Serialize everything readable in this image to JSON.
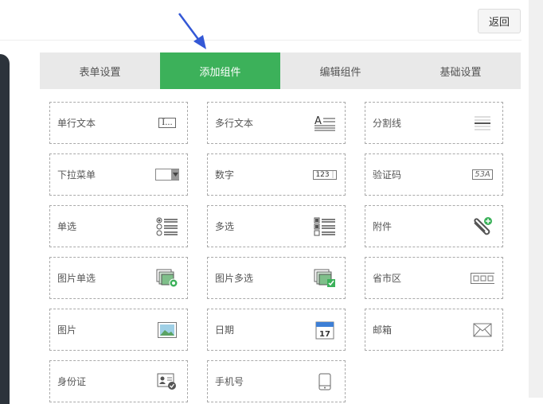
{
  "header": {
    "back_label": "返回"
  },
  "tabs": [
    {
      "label": "表单设置"
    },
    {
      "label": "添加组件",
      "active": true
    },
    {
      "label": "编辑组件"
    },
    {
      "label": "基础设置"
    }
  ],
  "colors": {
    "accent": "#3cb15a",
    "arrow": "#3458d6"
  },
  "components": [
    {
      "label": "单行文本",
      "icon": "text-input-icon"
    },
    {
      "label": "多行文本",
      "icon": "textarea-icon"
    },
    {
      "label": "分割线",
      "icon": "divider-icon"
    },
    {
      "label": "下拉菜单",
      "icon": "dropdown-icon"
    },
    {
      "label": "数字",
      "icon": "number-icon"
    },
    {
      "label": "验证码",
      "icon": "captcha-icon"
    },
    {
      "label": "单选",
      "icon": "radio-list-icon"
    },
    {
      "label": "多选",
      "icon": "checkbox-list-icon"
    },
    {
      "label": "附件",
      "icon": "attachment-icon"
    },
    {
      "label": "图片单选",
      "icon": "image-radio-icon"
    },
    {
      "label": "图片多选",
      "icon": "image-checkbox-icon"
    },
    {
      "label": "省市区",
      "icon": "region-icon"
    },
    {
      "label": "图片",
      "icon": "image-icon"
    },
    {
      "label": "日期",
      "icon": "calendar-icon"
    },
    {
      "label": "邮箱",
      "icon": "email-icon"
    },
    {
      "label": "身份证",
      "icon": "id-card-icon"
    },
    {
      "label": "手机号",
      "icon": "mobile-phone-icon"
    }
  ],
  "icon_text": {
    "text_input": "I...",
    "number": "123",
    "captcha": "53A",
    "calendar_day": "17"
  }
}
